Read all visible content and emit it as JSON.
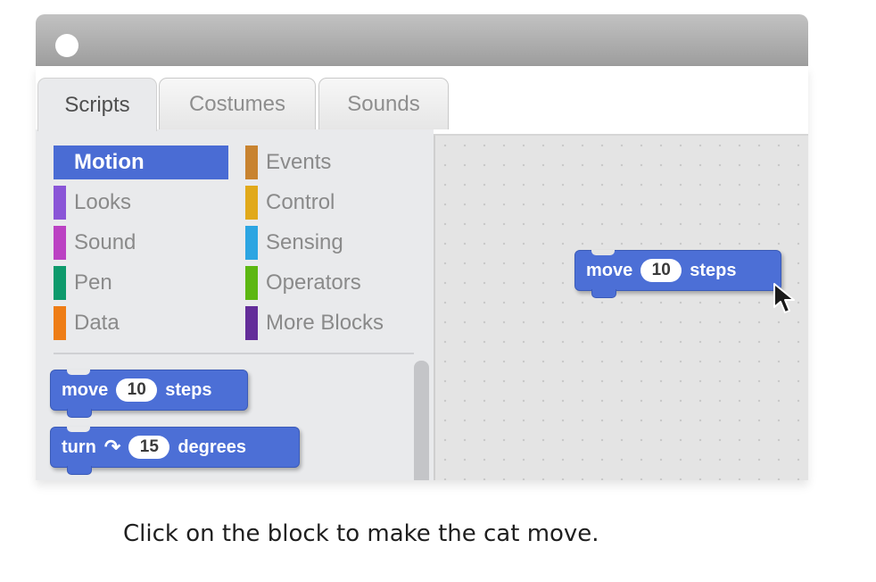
{
  "tabs": [
    {
      "label": "Scripts",
      "active": true
    },
    {
      "label": "Costumes",
      "active": false
    },
    {
      "label": "Sounds",
      "active": false
    }
  ],
  "categories": {
    "left": [
      {
        "label": "Motion",
        "color": "#4a6cd4",
        "selected": true
      },
      {
        "label": "Looks",
        "color": "#8a55d7"
      },
      {
        "label": "Sound",
        "color": "#bb42c3"
      },
      {
        "label": "Pen",
        "color": "#0e9a6c"
      },
      {
        "label": "Data",
        "color": "#ee7d16"
      }
    ],
    "right": [
      {
        "label": "Events",
        "color": "#c88330"
      },
      {
        "label": "Control",
        "color": "#e1a91a"
      },
      {
        "label": "Sensing",
        "color": "#2ca5e2"
      },
      {
        "label": "Operators",
        "color": "#5cb712"
      },
      {
        "label": "More Blocks",
        "color": "#632d99"
      }
    ]
  },
  "palette_blocks": {
    "move": {
      "prefix": "move",
      "value": "10",
      "suffix": "steps"
    },
    "turn": {
      "prefix": "turn",
      "glyph": "↷",
      "value": "15",
      "suffix": "degrees"
    }
  },
  "script_block": {
    "prefix": "move",
    "value": "10",
    "suffix": "steps"
  },
  "caption": "Click on the block to make the cat move.",
  "colors": {
    "motion_block": "#4c6fd6",
    "palette_bg": "#e9eaec",
    "script_bg": "#e4e4e4"
  }
}
